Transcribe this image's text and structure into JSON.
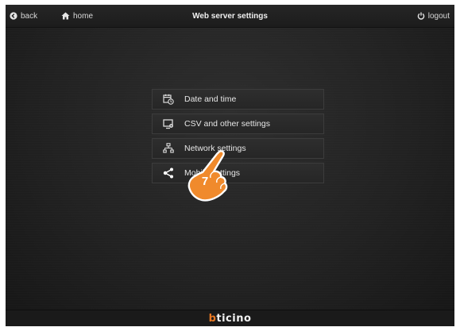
{
  "topbar": {
    "back_label": "back",
    "home_label": "home",
    "title": "Web server settings",
    "logout_label": "logout"
  },
  "menu": {
    "items": [
      {
        "label": "Date and time",
        "icon": "calendar-clock-icon"
      },
      {
        "label": "CSV and other settings",
        "icon": "monitor-settings-icon"
      },
      {
        "label": "Network settings",
        "icon": "network-icon"
      },
      {
        "label": "Mobile settings",
        "icon": "share-icon"
      }
    ]
  },
  "step_badge": "7",
  "footer": {
    "logo_first": "b",
    "logo_rest": "ticino"
  },
  "colors": {
    "background": "#222222",
    "accent": "#e87722",
    "hand_fill": "#f08a2c"
  }
}
